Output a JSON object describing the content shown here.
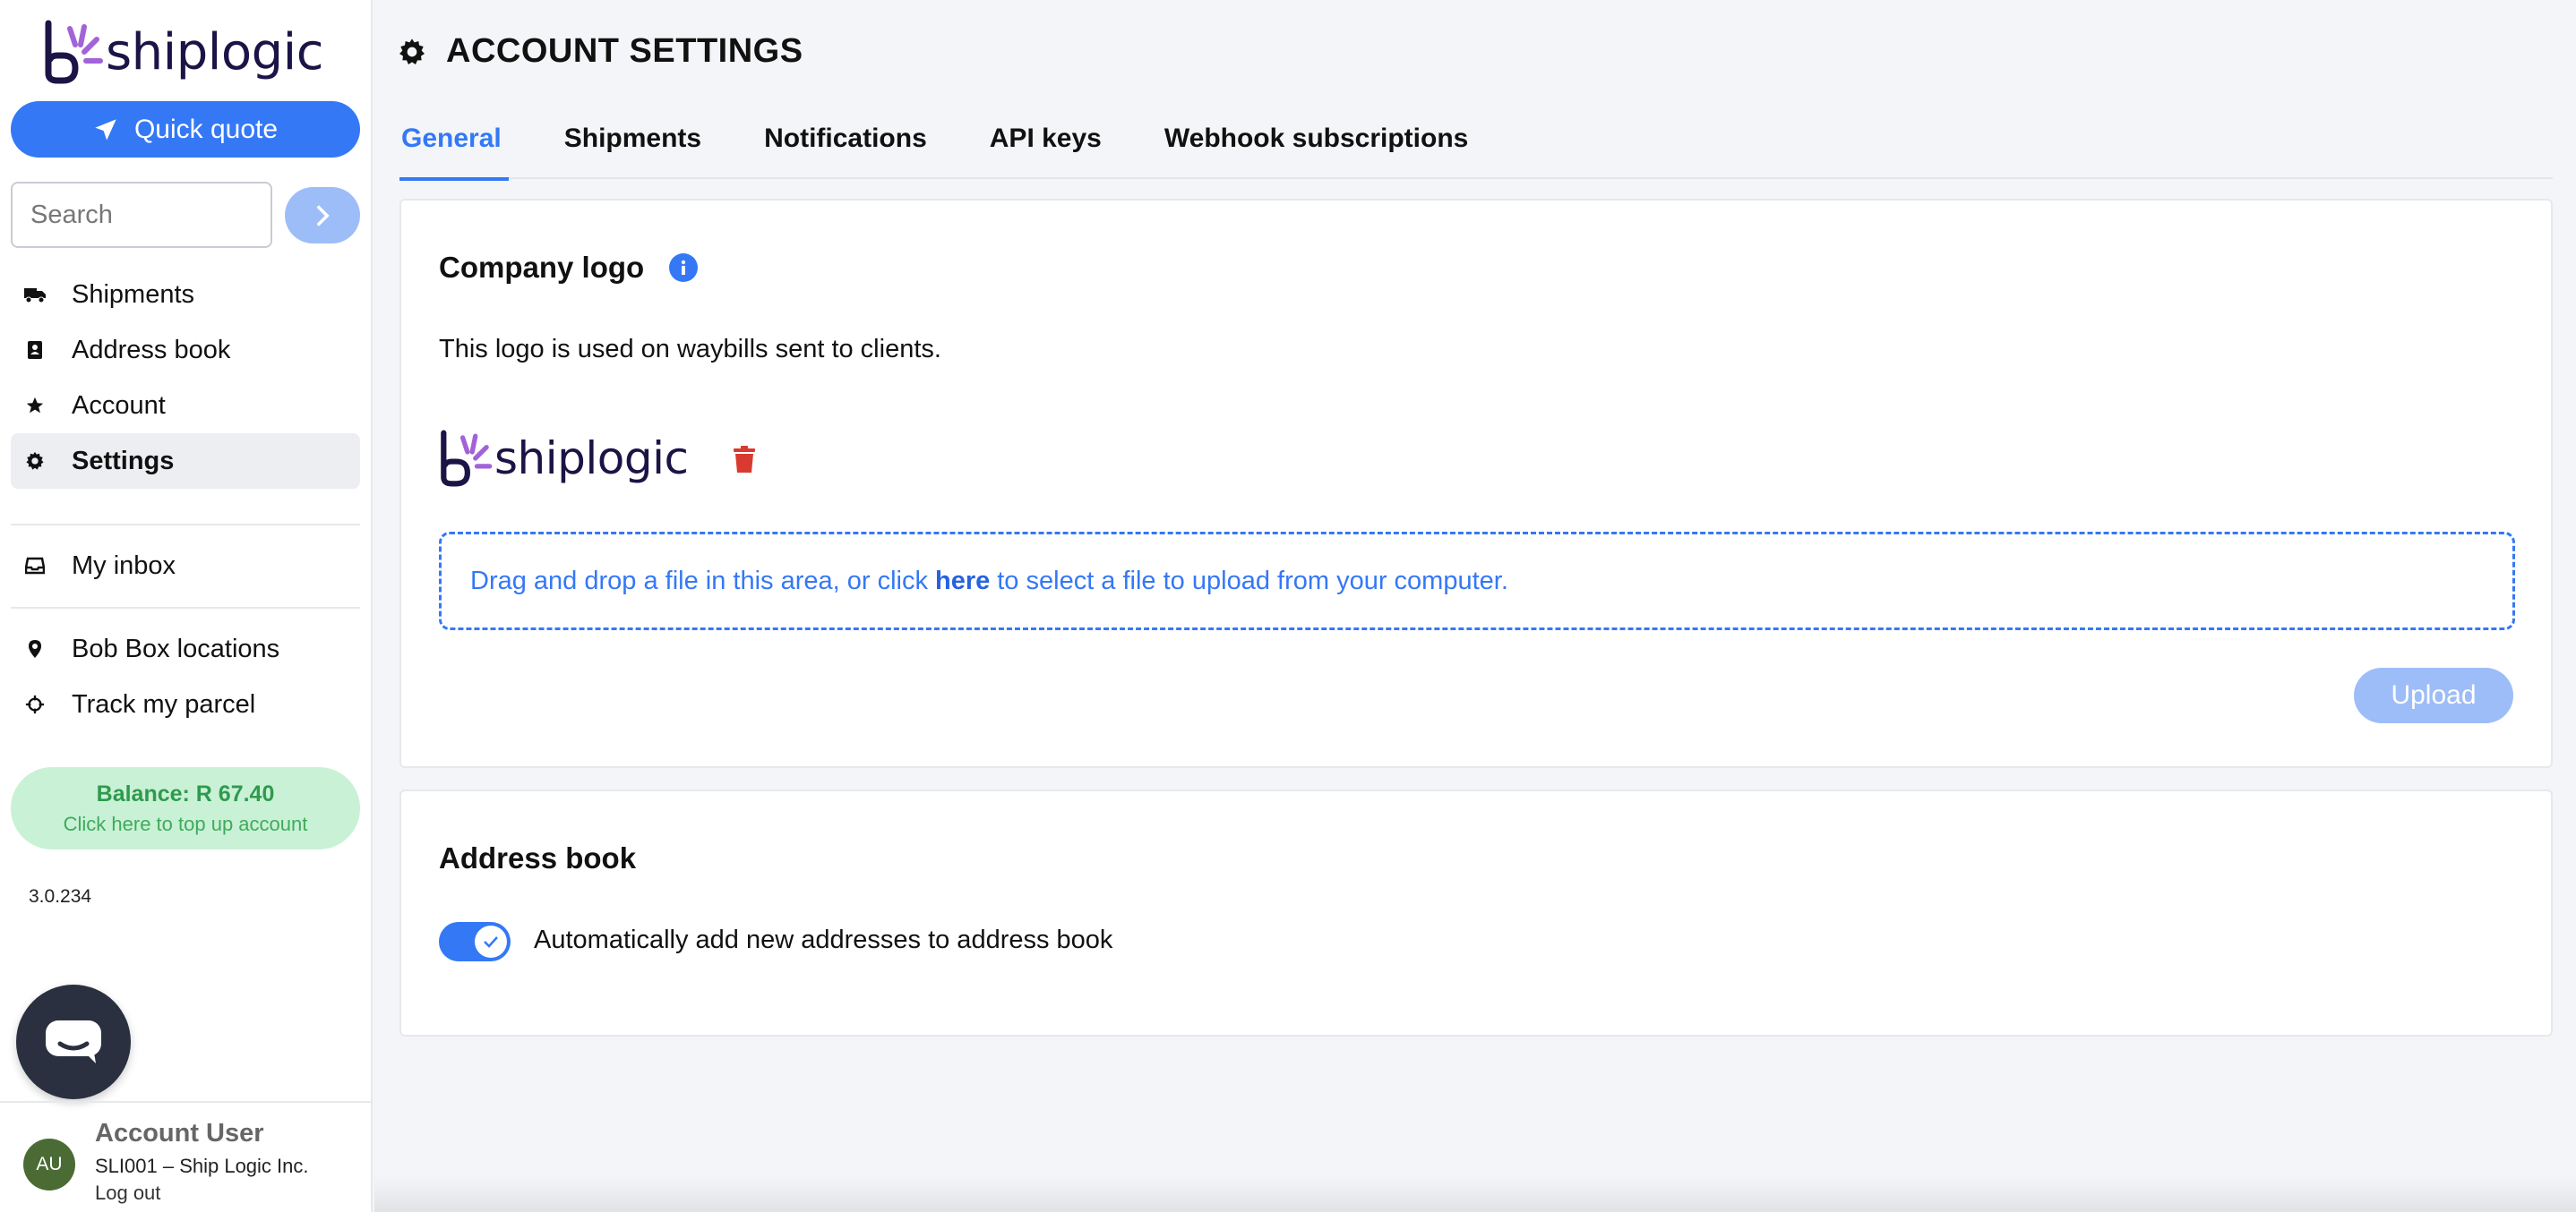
{
  "brand": {
    "name_part1": "ship",
    "name_part2": "logic",
    "accent": "#3478f6",
    "brand_purple": "#a263d8",
    "brand_navy": "#1b1446"
  },
  "sidebar": {
    "quick_quote_label": "Quick quote",
    "search_placeholder": "Search",
    "items": [
      {
        "label": "Shipments",
        "icon": "truck-icon"
      },
      {
        "label": "Address book",
        "icon": "address-book-icon"
      },
      {
        "label": "Account",
        "icon": "star-icon"
      },
      {
        "label": "Settings",
        "icon": "gear-icon",
        "active": true
      },
      {
        "label": "My inbox",
        "icon": "inbox-icon"
      },
      {
        "label": "Bob Box locations",
        "icon": "map-pin-icon"
      },
      {
        "label": "Track my parcel",
        "icon": "crosshair-icon"
      }
    ],
    "balance": {
      "label": "Balance: R 67.40",
      "sub": "Click here to top up account"
    },
    "version": "3.0.234",
    "user": {
      "initials": "AU",
      "name": "Account User",
      "org": "SLI001 – Ship Logic Inc.",
      "logout": "Log out"
    }
  },
  "main": {
    "page_title": "ACCOUNT SETTINGS",
    "tabs": [
      {
        "label": "General",
        "active": true
      },
      {
        "label": "Shipments"
      },
      {
        "label": "Notifications"
      },
      {
        "label": "API keys"
      },
      {
        "label": "Webhook subscriptions"
      }
    ],
    "company_logo": {
      "title": "Company logo",
      "description": "This logo is used on waybills sent to clients.",
      "drop_text_before": "Drag and drop a file in this area, or click",
      "drop_link": "here",
      "drop_text_after": "to select a file to upload from your computer.",
      "upload_label": "Upload"
    },
    "address_book": {
      "title": "Address book",
      "toggle_label": "Automatically add new addresses to address book",
      "toggle_on": true
    }
  }
}
